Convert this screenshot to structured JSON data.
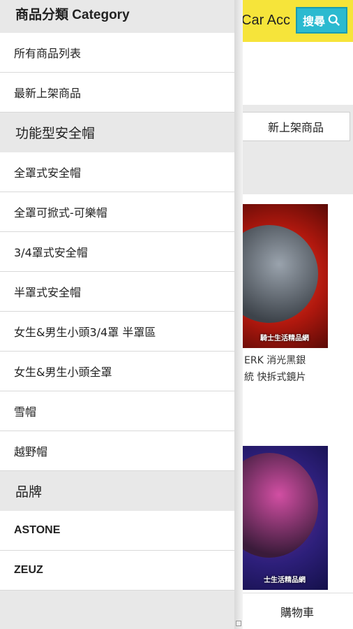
{
  "background": {
    "header_title": "Car Acc",
    "search_label": "搜尋",
    "tab_label": "新上架商品",
    "card1_caption": "騎士生活精品網",
    "card1_text_line1": "ERK 消光黑銀",
    "card1_text_line2": "統 快拆式鏡片",
    "card2_caption": "士生活精品網",
    "cart_label": "購物車",
    "colors": {
      "header": "#f6e43a",
      "search": "#2bbad0"
    }
  },
  "drawer": {
    "title": "商品分類 Category",
    "general_items": [
      "所有商品列表",
      "最新上架商品"
    ],
    "section_helmets": "功能型安全帽",
    "helmet_items": [
      "全罩式安全帽",
      "全罩可掀式-可樂帽",
      "3/4罩式安全帽",
      "半罩式安全帽",
      "女生&男生小頭3/4罩 半罩區",
      "女生&男生小頭全罩",
      "雪帽",
      "越野帽"
    ],
    "section_brands": "品牌",
    "brand_items": [
      "ASTONE",
      "ZEUZ"
    ]
  }
}
